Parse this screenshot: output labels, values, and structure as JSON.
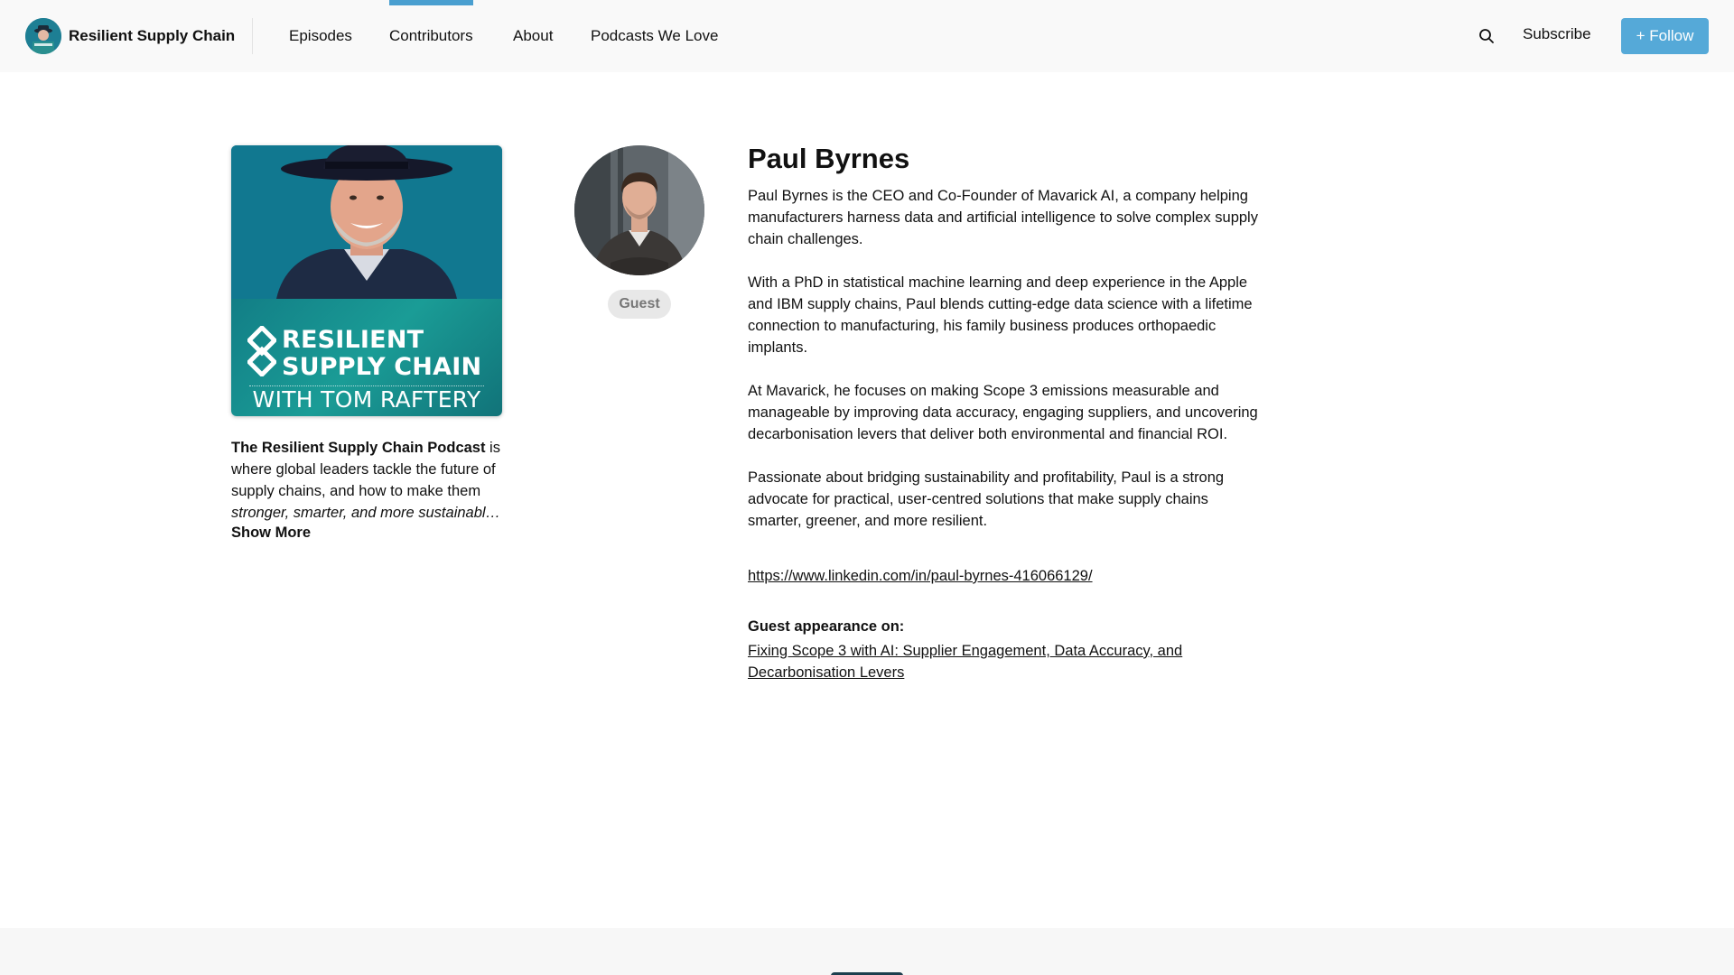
{
  "header": {
    "brand_name": "Resilient Supply Chain",
    "nav": [
      {
        "label": "Episodes",
        "active": false
      },
      {
        "label": "Contributors",
        "active": true
      },
      {
        "label": "About",
        "active": false
      },
      {
        "label": "Podcasts We Love",
        "active": false
      }
    ],
    "search_icon": "search-icon",
    "subscribe_label": "Subscribe",
    "follow_label": "+ Follow",
    "accent_color": "#55a9d8"
  },
  "podcast": {
    "cover": {
      "title_line1": "RESILIENT",
      "title_line2": "SUPPLY CHAIN",
      "subtitle": "WITH TOM RAFTERY"
    },
    "description_bold": "The Resilient Supply Chain Podcast",
    "description_rest": " is where global leaders tackle the future of supply chains, and how to make them ",
    "description_italic": "stronger, smarter, and more sustainabl…",
    "show_more_label": "Show More"
  },
  "contributor": {
    "name": "Paul Byrnes",
    "role": "Guest",
    "bio": [
      "Paul Byrnes is the CEO and Co-Founder of Mavarick AI, a company helping manufacturers harness data and artificial intelligence to solve complex supply chain challenges.",
      "With a PhD in statistical machine learning and deep experience in the Apple and IBM supply chains, Paul blends cutting-edge data science with a lifetime connection to manufacturing, his family business produces orthopaedic implants.",
      "At Mavarick, he focuses on making Scope 3 emissions measurable and manageable by improving data accuracy, engaging suppliers, and uncovering decarbonisation levers that deliver both environmental and financial ROI.",
      "Passionate about bridging sustainability and profitability, Paul is a strong advocate for practical, user-centred solutions that make supply chains smarter, greener, and more resilient."
    ],
    "link": "https://www.linkedin.com/in/paul-byrnes-416066129/",
    "appearance_heading": "Guest appearance on:",
    "appearance_episode": "Fixing Scope 3 with AI: Supplier Engagement, Data Accuracy, and Decarbonisation Levers"
  }
}
